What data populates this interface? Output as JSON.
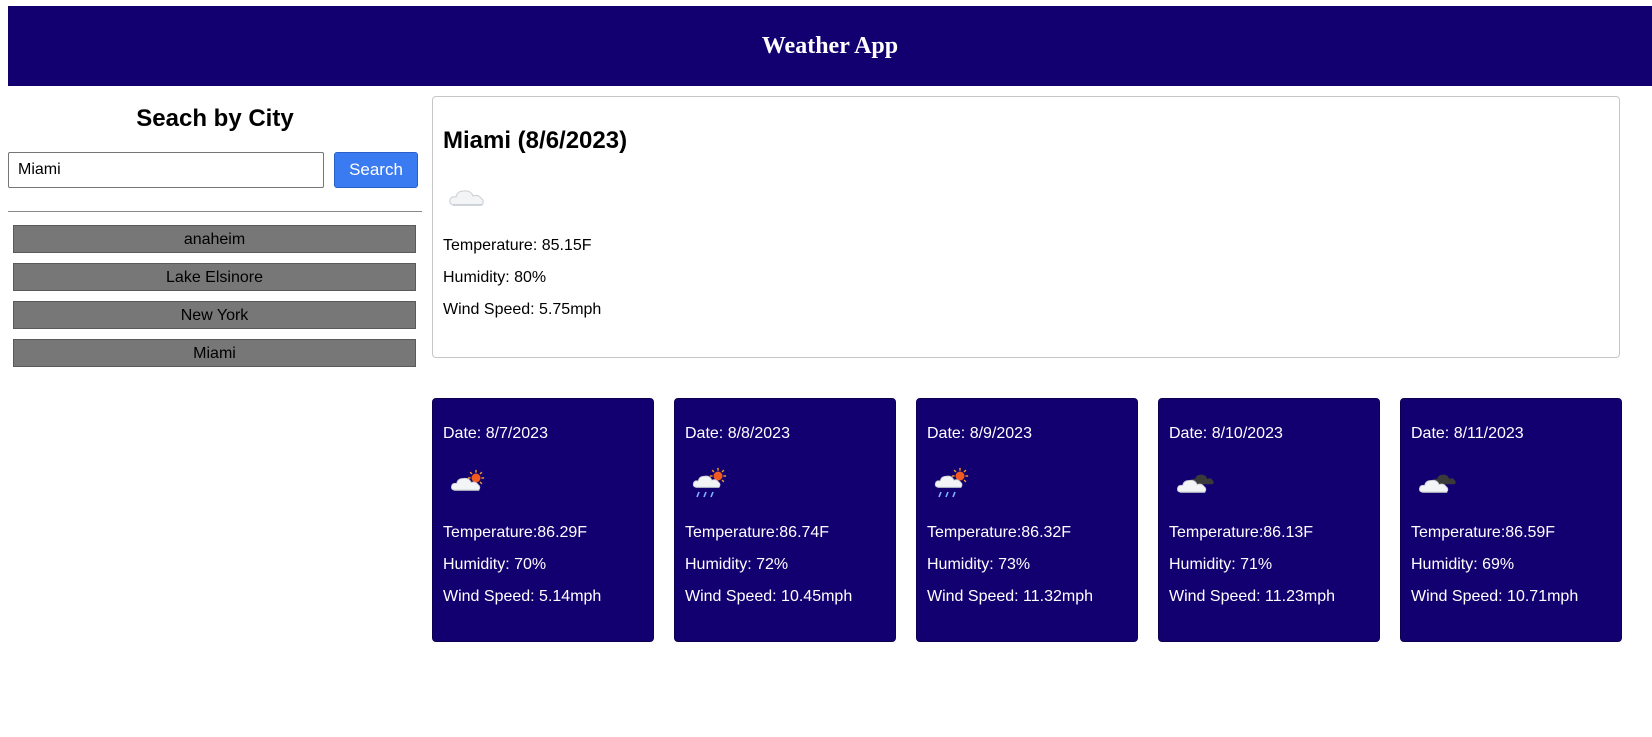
{
  "header": {
    "title": "Weather App"
  },
  "sidebar": {
    "heading": "Seach by City",
    "search": {
      "value": "Miami",
      "button_label": "Search"
    },
    "history": [
      "anaheim",
      "Lake Elsinore",
      "New York",
      "Miami"
    ]
  },
  "current": {
    "title": "Miami (8/6/2023)",
    "icon": "cloud-icon",
    "temperature": "Temperature: 85.15F",
    "humidity": "Humidity: 80%",
    "wind": "Wind Speed: 5.75mph"
  },
  "forecast": [
    {
      "date": "Date: 8/7/2023",
      "icon": "cloud-sun-icon",
      "temperature": "Temperature:86.29F",
      "humidity": "Humidity: 70%",
      "wind": "Wind Speed: 5.14mph"
    },
    {
      "date": "Date: 8/8/2023",
      "icon": "rain-sun-icon",
      "temperature": "Temperature:86.74F",
      "humidity": "Humidity: 72%",
      "wind": "Wind Speed: 10.45mph"
    },
    {
      "date": "Date: 8/9/2023",
      "icon": "rain-sun-icon",
      "temperature": "Temperature:86.32F",
      "humidity": "Humidity: 73%",
      "wind": "Wind Speed: 11.32mph"
    },
    {
      "date": "Date: 8/10/2023",
      "icon": "dark-clouds-icon",
      "temperature": "Temperature:86.13F",
      "humidity": "Humidity: 71%",
      "wind": "Wind Speed: 11.23mph"
    },
    {
      "date": "Date: 8/11/2023",
      "icon": "dark-clouds-icon",
      "temperature": "Temperature:86.59F",
      "humidity": "Humidity: 69%",
      "wind": "Wind Speed: 10.71mph"
    }
  ],
  "colors": {
    "header_bg": "#120070",
    "forecast_bg": "#120070",
    "search_button": "#3b7bf2",
    "history_bg": "#777777"
  }
}
